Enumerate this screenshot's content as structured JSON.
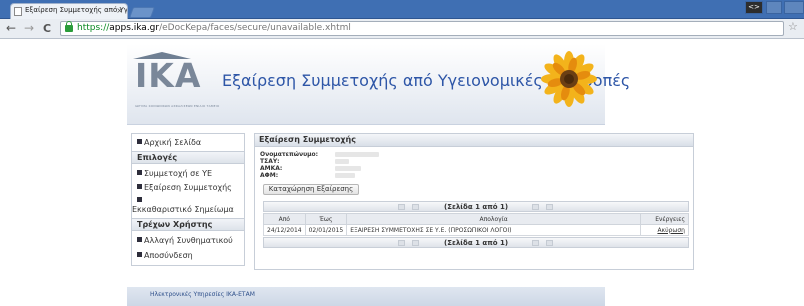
{
  "browser": {
    "tab_title": "Εξαίρεση Συμμετοχής από Υγ",
    "tab_close": "×",
    "url_scheme": "https://",
    "url_host": "apps.ika.gr",
    "url_path": "/eDocKepa/faces/secure/unavailable.xhtml",
    "back": "←",
    "forward": "→",
    "reload": "C",
    "star": "☆",
    "ext_label": "<>"
  },
  "banner": {
    "logo_text": "IKA",
    "logo_subtitle": "ΙΔΡΥΜΑ ΚΟΙΝΩΝΙΚΩΝ ΑΣΦΑΛΙΣΕΩΝ ΕΝΙΑΙΟ ΤΑΜΕΙΟ",
    "title": "Εξαίρεση Συμμετοχής από Υγειονομικές Επιτροπές"
  },
  "sidebar": {
    "home": "Αρχική Σελίδα",
    "options_heading": "Επιλογές",
    "items": [
      "Συμμετοχή σε ΥΕ",
      "Εξαίρεση Συμμετοχής",
      "Εκκαθαριστικό Σημείωμα"
    ],
    "user_heading": "Τρέχων Χρήστης",
    "user_items": [
      "Αλλαγή Συνθηματικού",
      "Αποσύνδεση"
    ]
  },
  "panel": {
    "title": "Εξαίρεση Συμμετοχής",
    "fields": [
      {
        "label": "Ονοματεπώνυμο:"
      },
      {
        "label": "ΤΣΑΥ:"
      },
      {
        "label": "ΑΜΚΑ:"
      },
      {
        "label": "ΑΦΜ:"
      }
    ],
    "register_button": "Καταχώρηση Εξαίρεσης",
    "pager_text": "(Σελίδα 1 από 1)",
    "table": {
      "headers": [
        "Από",
        "Έως",
        "Απολογία",
        "Ενέργειες"
      ],
      "rows": [
        {
          "from": "24/12/2014",
          "to": "02/01/2015",
          "reason": "ΕΞΑΙΡΕΣΗ ΣΥΜΜΕΤΟΧΗΣ ΣΕ Υ.Ε. (ΠΡΟΣΩΠΙΚΟΙ ΛΟΓΟΙ)",
          "action": "Ακύρωση"
        }
      ]
    }
  },
  "footer": {
    "text": "Ηλεκτρονικές Υπηρεσίες ΙΚΑ-ΕΤΑΜ"
  },
  "colors": {
    "accent": "#2e56a7",
    "titlebar": "#3f6fb3"
  }
}
